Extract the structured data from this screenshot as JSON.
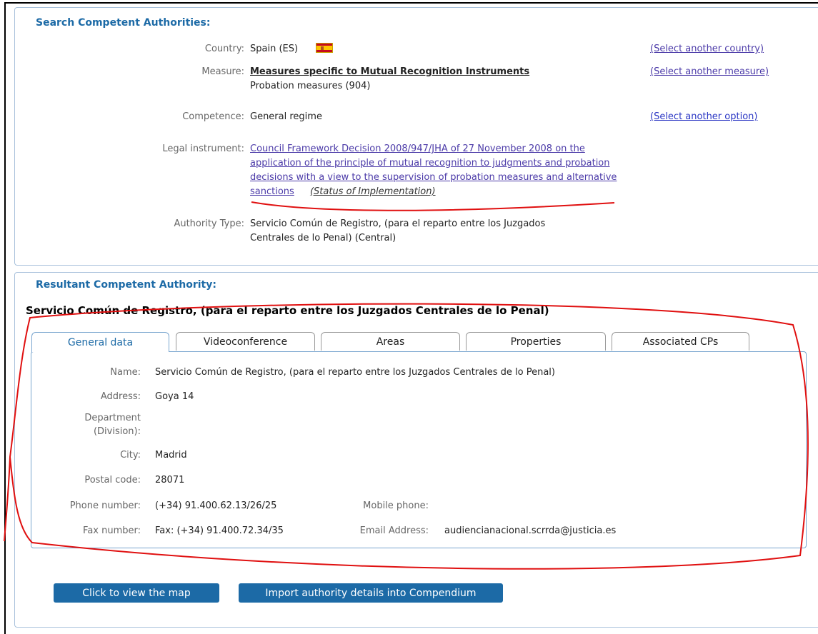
{
  "search": {
    "title": "Search Competent Authorities:",
    "country_label": "Country:",
    "country_value": "Spain (ES)",
    "country_change": "(Select another country)",
    "measure_label": "Measure:",
    "measure_value": "Measures specific to Mutual Recognition Instruments",
    "measure_sub": "Probation measures (904)",
    "measure_change": "(Select another measure)",
    "competence_label": "Competence:",
    "competence_value": "General regime",
    "competence_change": "(Select another option)",
    "legal_label": "Legal instrument:",
    "legal_value": "Council Framework Decision 2008/947/JHA of 27 November 2008 on the application of the principle of mutual recognition to judgments and probation decisions with a view to the supervision of probation measures and alternative sanctions",
    "legal_status": "(Status of Implementation)",
    "authority_label": "Authority Type:",
    "authority_value_1": "Servicio Común de Registro, (para el reparto entre los Juzgados",
    "authority_value_2": "Centrales de lo Penal) (Central)"
  },
  "result": {
    "title": "Resultant Competent Authority:",
    "authority_name": "Servicio Común de Registro, (para el reparto entre los Juzgados Centrales de lo Penal)",
    "tabs": [
      "General data",
      "Videoconference",
      "Areas",
      "Properties",
      "Associated CPs"
    ],
    "fields": {
      "name_label": "Name:",
      "name_value": "Servicio Común de Registro, (para el reparto entre los Juzgados Centrales de lo Penal)",
      "address_label": "Address:",
      "address_value": "Goya 14",
      "department_label_1": "Department",
      "department_label_2": "(Division):",
      "department_value": "",
      "city_label": "City:",
      "city_value": "Madrid",
      "postal_label": "Postal code:",
      "postal_value": "28071",
      "phone_label": "Phone number:",
      "phone_value": "(+34) 91.400.62.13/26/25",
      "mobile_label": "Mobile phone:",
      "mobile_value": "",
      "fax_label": "Fax number:",
      "fax_value": "Fax: (+34) 91.400.72.34/35",
      "email_label": "Email Address:",
      "email_value": "audiencianacional.scrrda@justicia.es"
    },
    "buttons": {
      "map": "Click to view the map",
      "import": "Import authority details into Compendium"
    }
  },
  "colors": {
    "accent": "#1c6aa6",
    "annotation": "#e01010"
  }
}
